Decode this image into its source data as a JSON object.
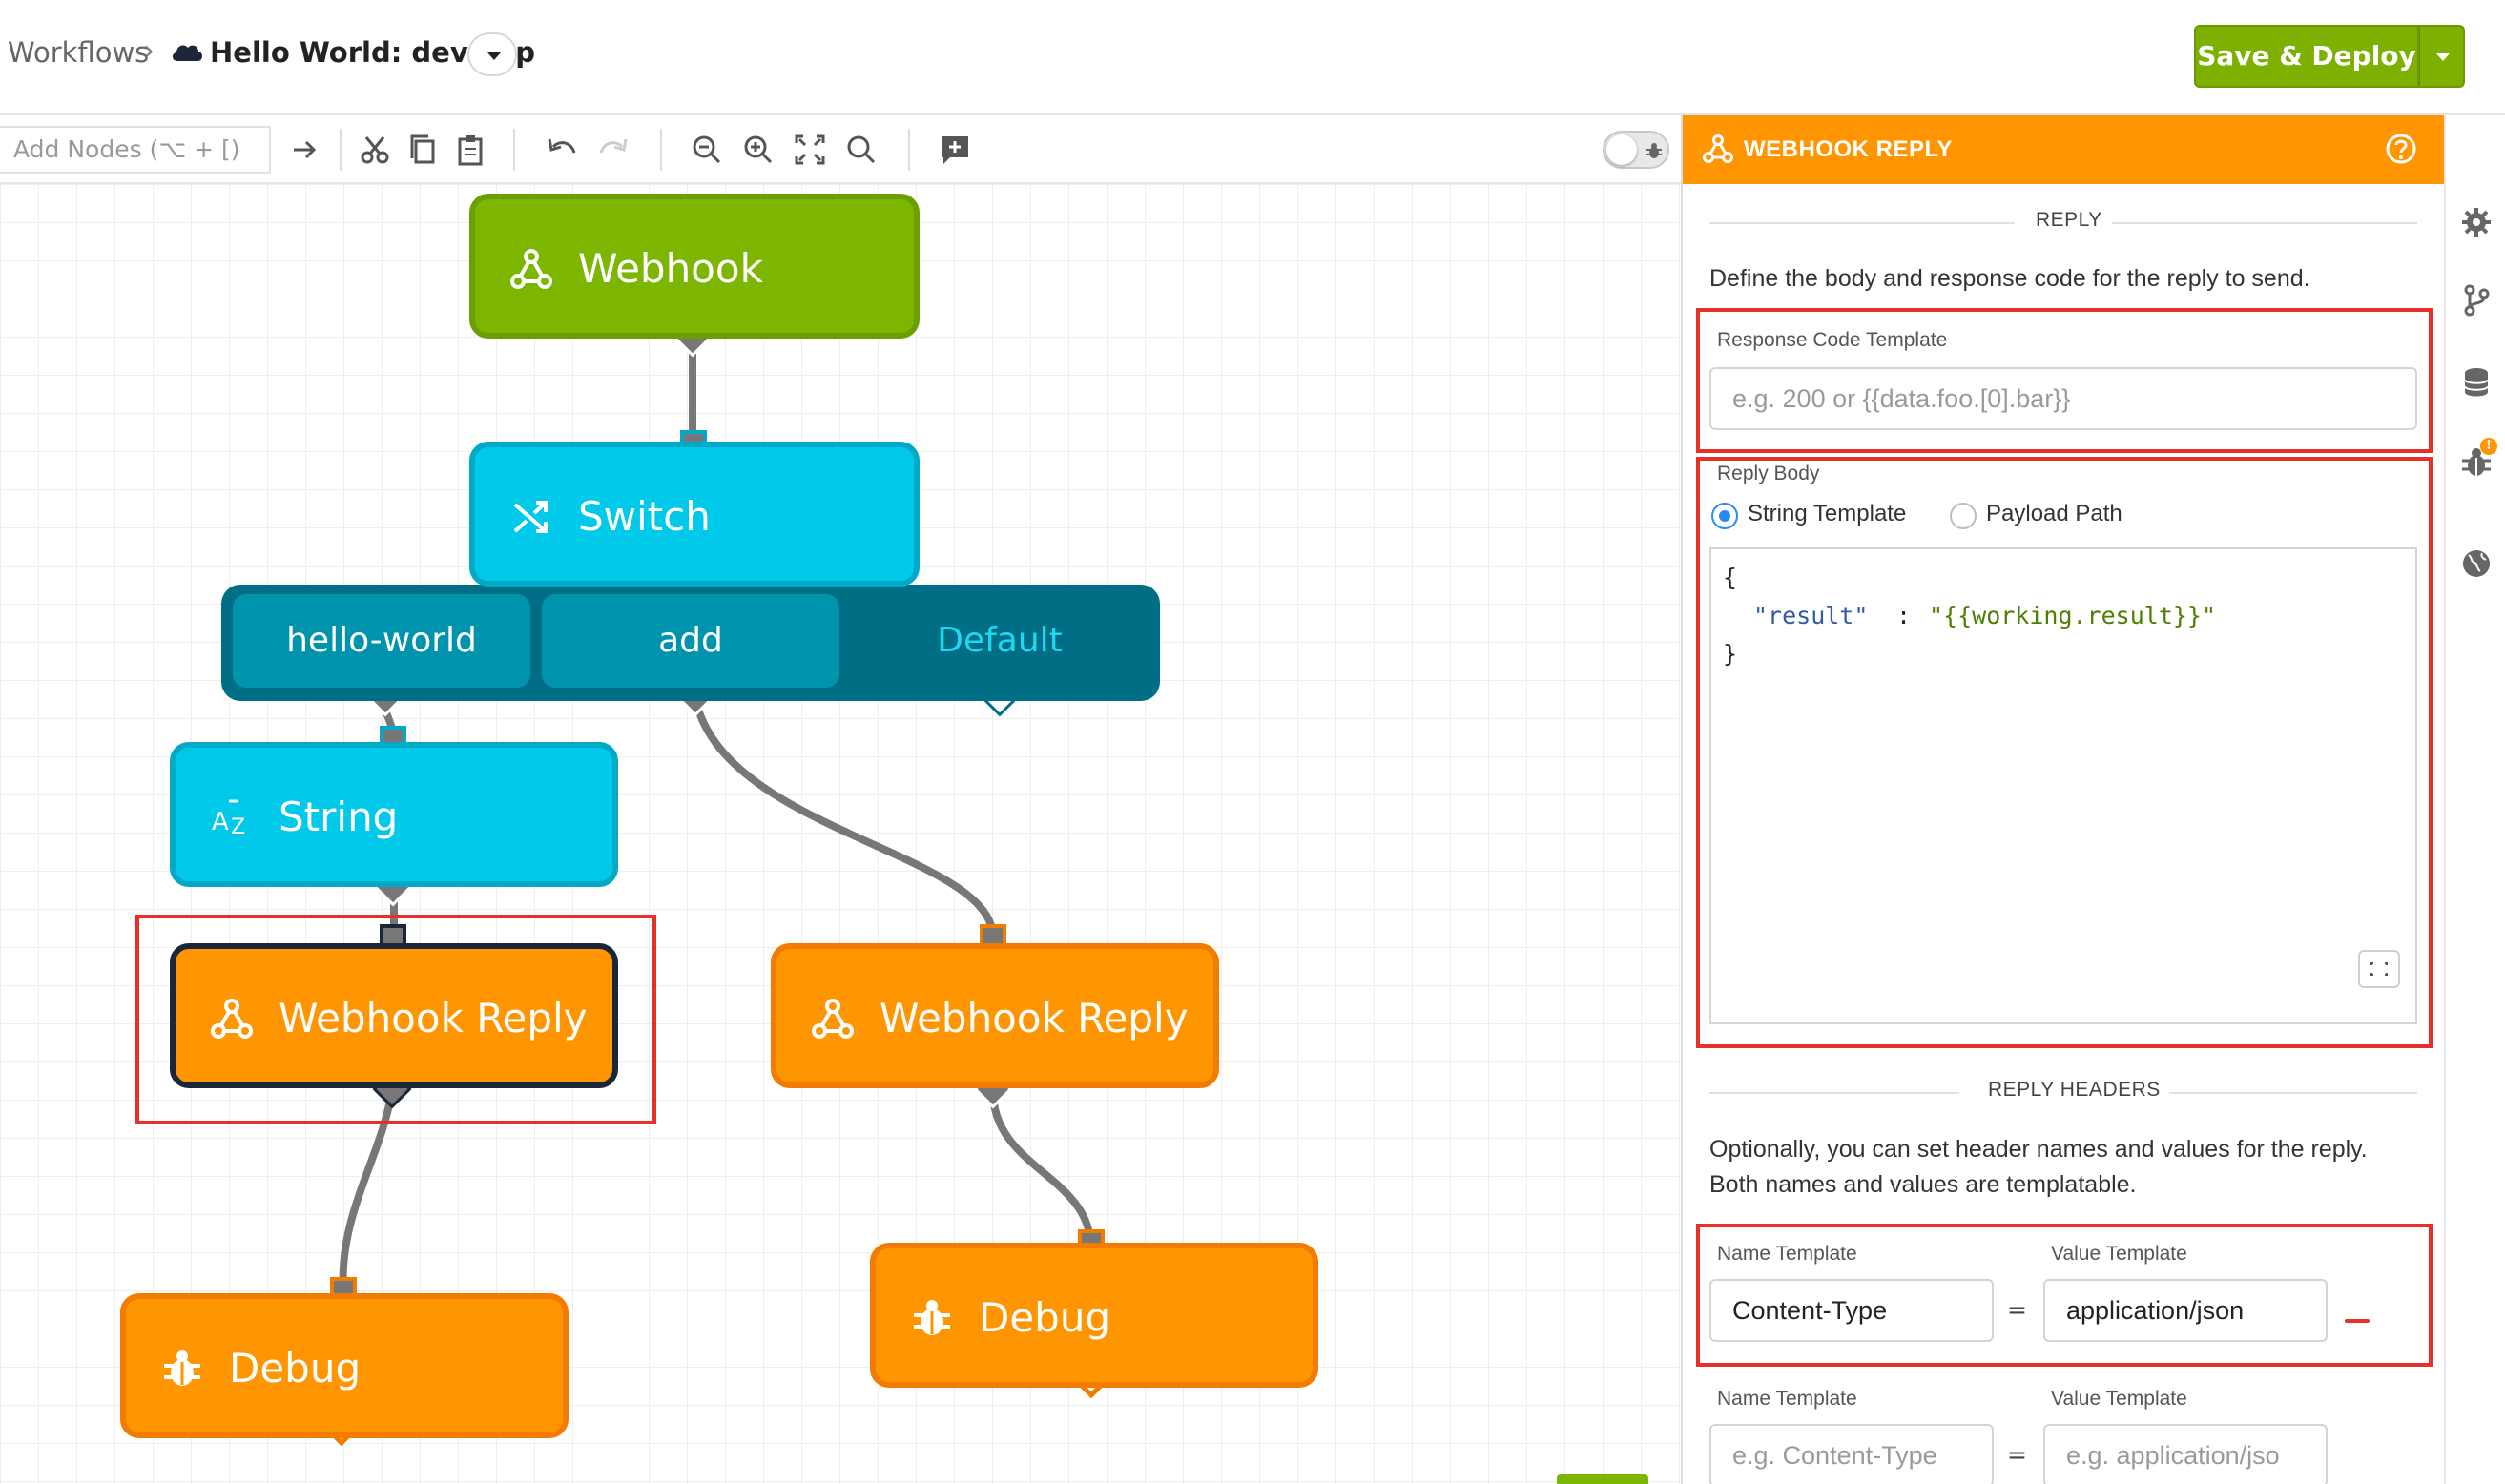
{
  "header": {
    "breadcrumb_root": "Workflows",
    "breadcrumb_sep": "›",
    "workflow_title": "Hello World: develop",
    "save_label": "Save & Deploy"
  },
  "toolbar": {
    "add_nodes_placeholder": "Add Nodes (⌥ + [)",
    "icons": [
      "arrow-right-icon",
      "cut-icon",
      "copy-icon",
      "paste-icon",
      "undo-icon",
      "redo-icon",
      "zoom-out-icon",
      "zoom-in-icon",
      "fit-icon",
      "search-icon",
      "comment-icon",
      "debug-toggle"
    ]
  },
  "canvas": {
    "nodes": {
      "webhook": "Webhook",
      "switch": "Switch",
      "switch_cases": [
        "hello-world",
        "add",
        "Default"
      ],
      "string": "String",
      "webhook_reply_1": "Webhook Reply",
      "webhook_reply_2": "Webhook Reply",
      "debug_1": "Debug",
      "debug_2": "Debug"
    }
  },
  "panel": {
    "title": "WEBHOOK REPLY",
    "section_reply": "REPLY",
    "reply_description": "Define the body and response code for the reply to send.",
    "response_code_label": "Response Code Template",
    "response_code_placeholder": "e.g. 200 or {{data.foo.[0].bar}}",
    "reply_body_label": "Reply Body",
    "radio_string_template": "String Template",
    "radio_payload_path": "Payload Path",
    "selected_body_mode": "String Template",
    "code_lines": [
      "{",
      "\"result\"",
      ":",
      "\"{{working.result}}\"",
      "}"
    ],
    "section_headers": "REPLY HEADERS",
    "headers_description_1": "Optionally, you can set header names and values for the reply.",
    "headers_description_2": "Both names and values are templatable.",
    "header_rows": [
      {
        "name_label": "Name Template",
        "value_label": "Value Template",
        "name": "Content-Type",
        "value": "application/json",
        "eq": "="
      },
      {
        "name_label": "Name Template",
        "value_label": "Value Template",
        "name_placeholder": "e.g. Content-Type",
        "value_placeholder": "e.g. application/jso",
        "eq": "="
      }
    ]
  },
  "rail": {
    "icons": [
      "gear-icon",
      "branch-icon",
      "database-icon",
      "bug-icon",
      "globe-icon"
    ],
    "bug_badge": "!"
  },
  "colors": {
    "accent_orange": "#ff9500",
    "save_green": "#7db000",
    "node_green": "#7db600",
    "node_cyan": "#00c9ea",
    "switch_dark": "#006f85",
    "highlight_red": "#e6302a",
    "radio_blue": "#2a8bf2"
  }
}
